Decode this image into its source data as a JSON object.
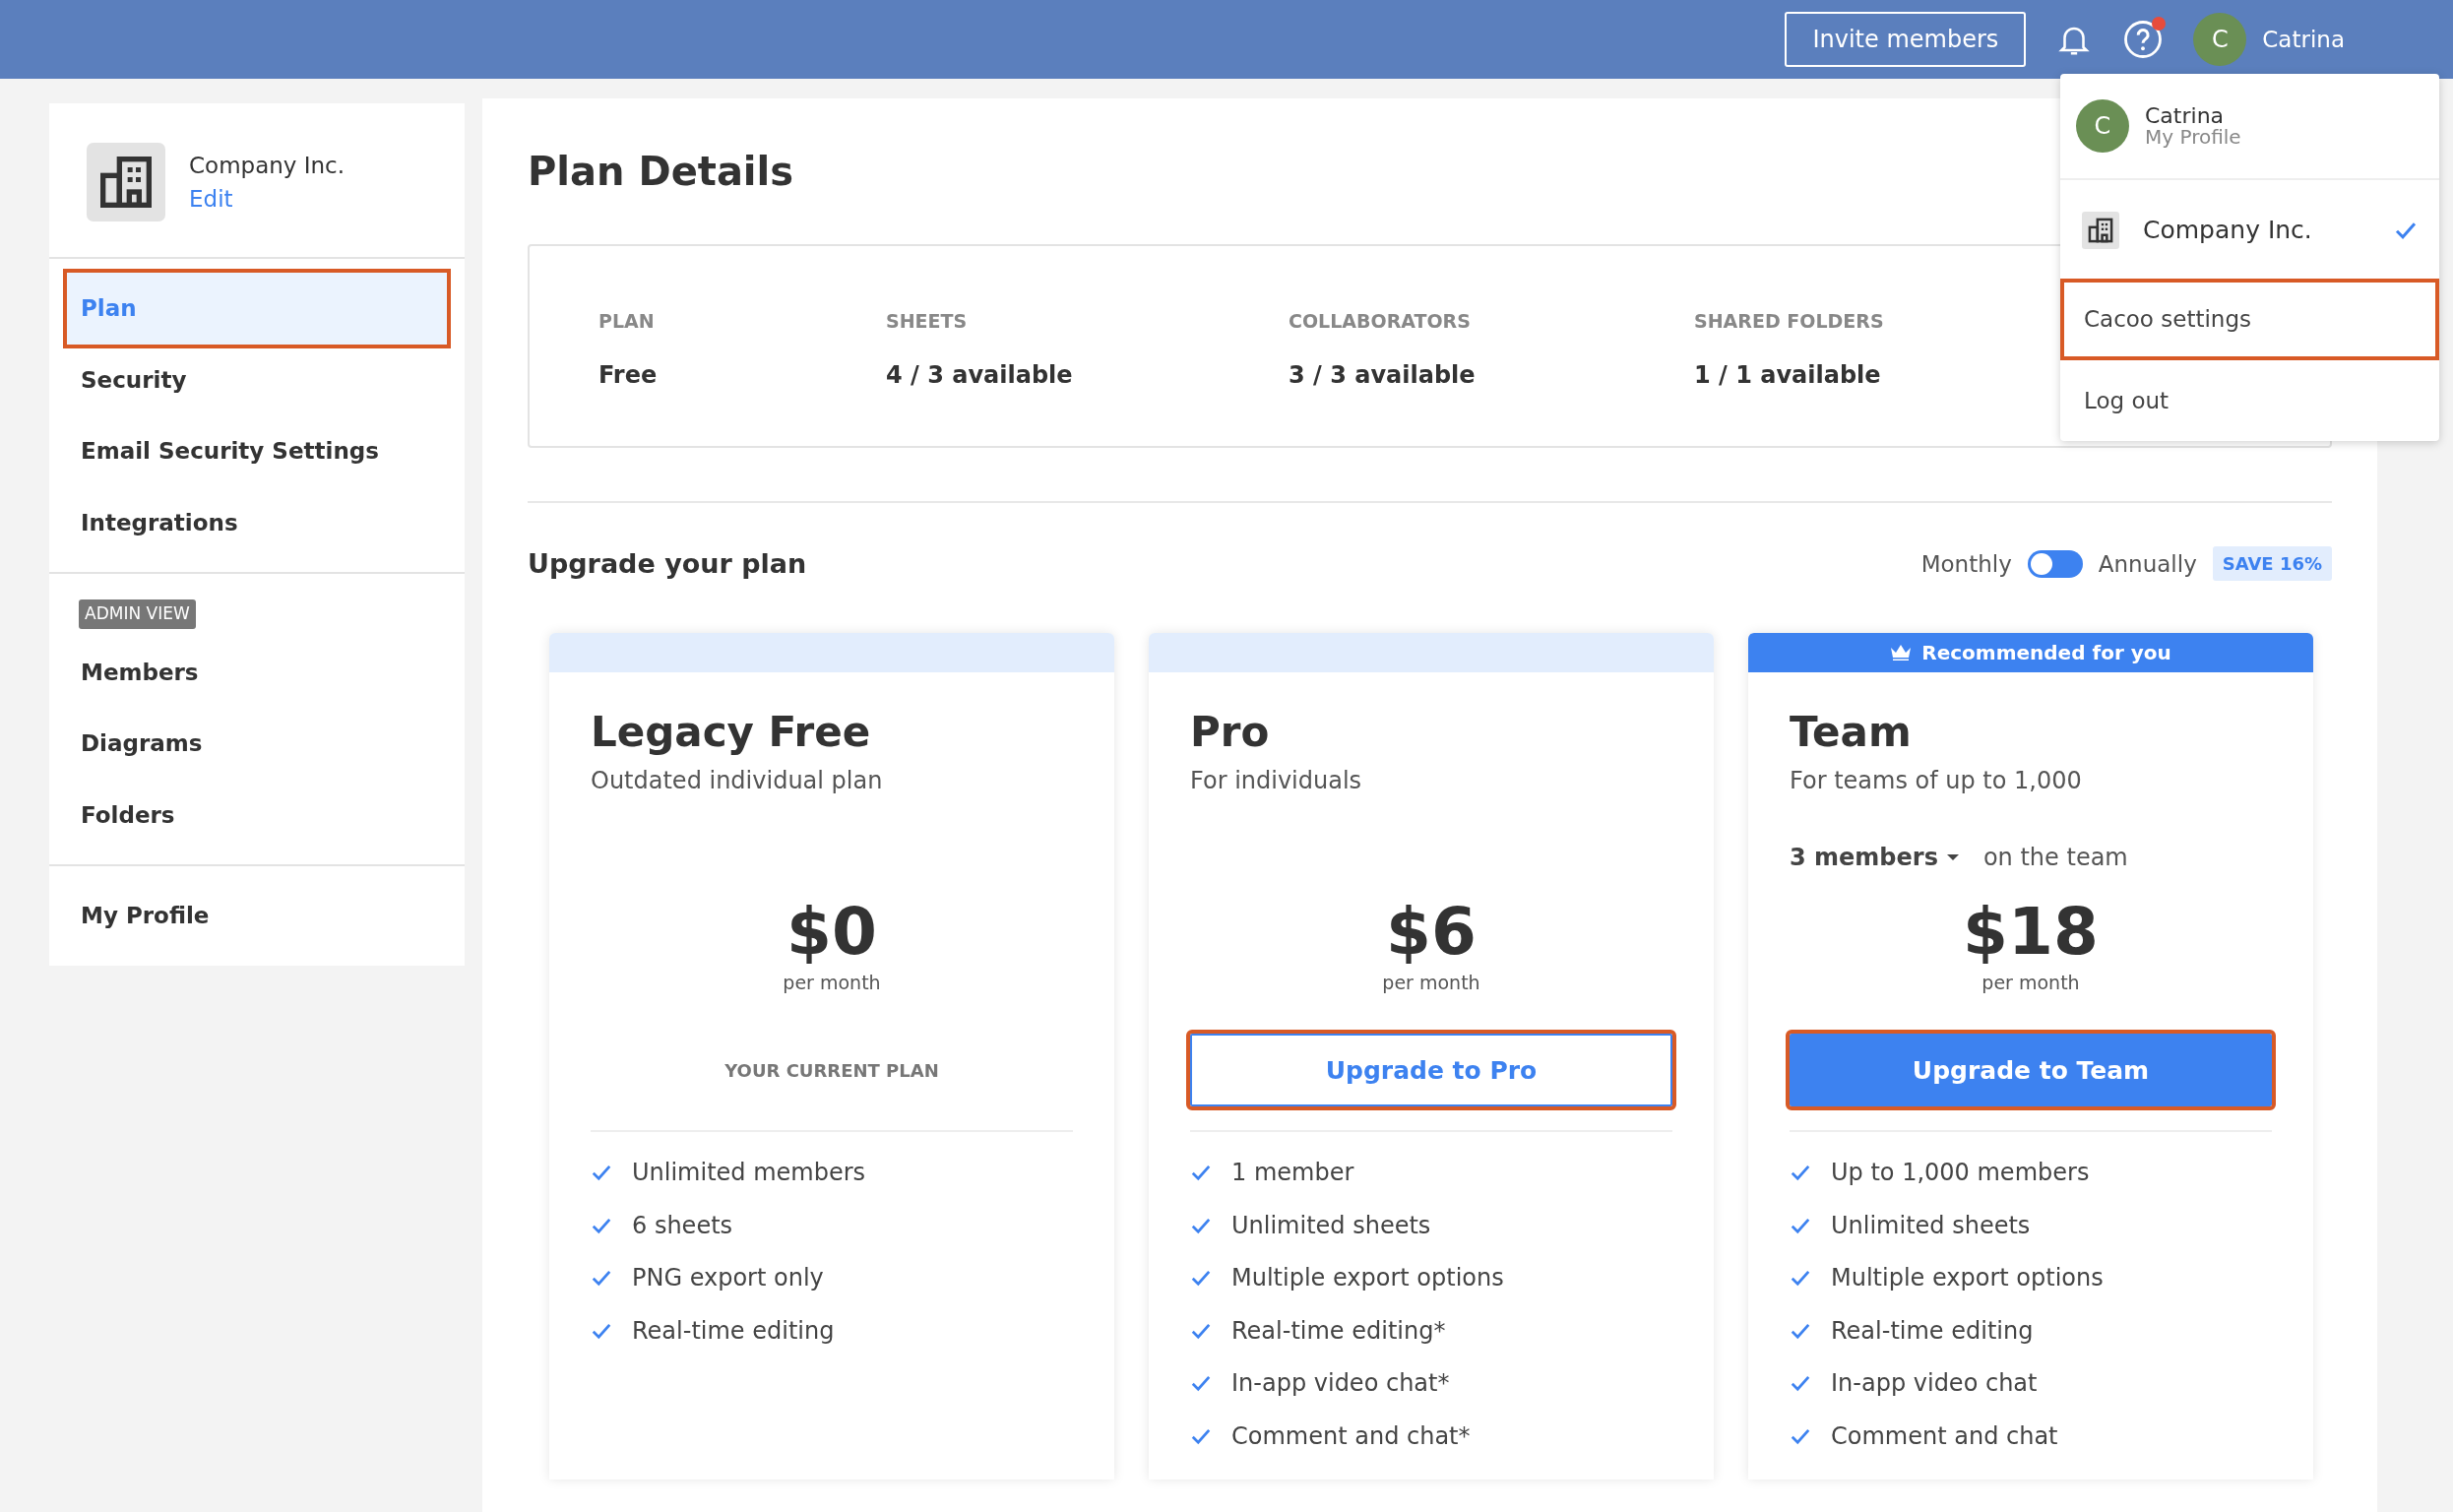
{
  "topbar": {
    "invite_button": "Invite members",
    "help_has_alert": true,
    "user": {
      "initial": "C",
      "name": "Catrina"
    }
  },
  "user_menu": {
    "profile": {
      "initial": "C",
      "name": "Catrina",
      "subtitle": "My Profile"
    },
    "workspaces": [
      {
        "name": "Company Inc.",
        "checked": true
      }
    ],
    "items": [
      {
        "label": "Cacoo settings",
        "highlighted": true
      },
      {
        "label": "Log out",
        "highlighted": false
      }
    ]
  },
  "sidebar": {
    "org": {
      "name": "Company Inc.",
      "edit_link": "Edit"
    },
    "sections": [
      {
        "items": [
          {
            "label": "Plan",
            "selected": true,
            "highlighted": true
          },
          {
            "label": "Security",
            "selected": false,
            "highlighted": false
          },
          {
            "label": "Email Security Settings",
            "selected": false,
            "highlighted": false
          },
          {
            "label": "Integrations",
            "selected": false,
            "highlighted": false
          }
        ]
      },
      {
        "badge": "ADMIN VIEW",
        "items": [
          {
            "label": "Members",
            "selected": false,
            "highlighted": false
          },
          {
            "label": "Diagrams",
            "selected": false,
            "highlighted": false
          },
          {
            "label": "Folders",
            "selected": false,
            "highlighted": false
          }
        ]
      },
      {
        "items": [
          {
            "label": "My Profile",
            "selected": false,
            "highlighted": false
          }
        ]
      }
    ]
  },
  "plan_details": {
    "title": "Plan Details",
    "stats": [
      {
        "label": "PLAN",
        "value": "Free"
      },
      {
        "label": "SHEETS",
        "value": "4 / 3 available"
      },
      {
        "label": "COLLABORATORS",
        "value": "3 / 3 available"
      },
      {
        "label": "SHARED FOLDERS",
        "value": "1 / 1 available"
      }
    ]
  },
  "upgrade": {
    "title": "Upgrade your plan",
    "billing": {
      "monthly_label": "Monthly",
      "annually_label": "Annually",
      "annual_selected": false,
      "save_badge": "SAVE 16%"
    },
    "plans": [
      {
        "name": "Legacy Free",
        "subtitle": "Outdated individual plan",
        "price": "$0",
        "period": "per month",
        "action": {
          "kind": "current",
          "label": "YOUR CURRENT PLAN",
          "highlighted": false
        },
        "features": [
          "Unlimited members",
          "6 sheets",
          "PNG export only",
          "Real-time editing"
        ]
      },
      {
        "name": "Pro",
        "subtitle": "For individuals",
        "price": "$6",
        "period": "per month",
        "action": {
          "kind": "outline",
          "label": "Upgrade to Pro",
          "highlighted": true
        },
        "features": [
          "1 member",
          "Unlimited sheets",
          "Multiple export options",
          "Real-time editing*",
          "In-app video chat*",
          "Comment and chat*"
        ]
      },
      {
        "name": "Team",
        "subtitle": "For teams of up to 1,000",
        "recommended_label": "Recommended for you",
        "members_selector": {
          "value": "3 members",
          "suffix": "on the team"
        },
        "price": "$18",
        "period": "per month",
        "action": {
          "kind": "primary",
          "label": "Upgrade to Team",
          "highlighted": true
        },
        "features": [
          "Up to 1,000 members",
          "Unlimited sheets",
          "Multiple export options",
          "Real-time editing",
          "In-app video chat",
          "Comment and chat"
        ]
      }
    ]
  }
}
